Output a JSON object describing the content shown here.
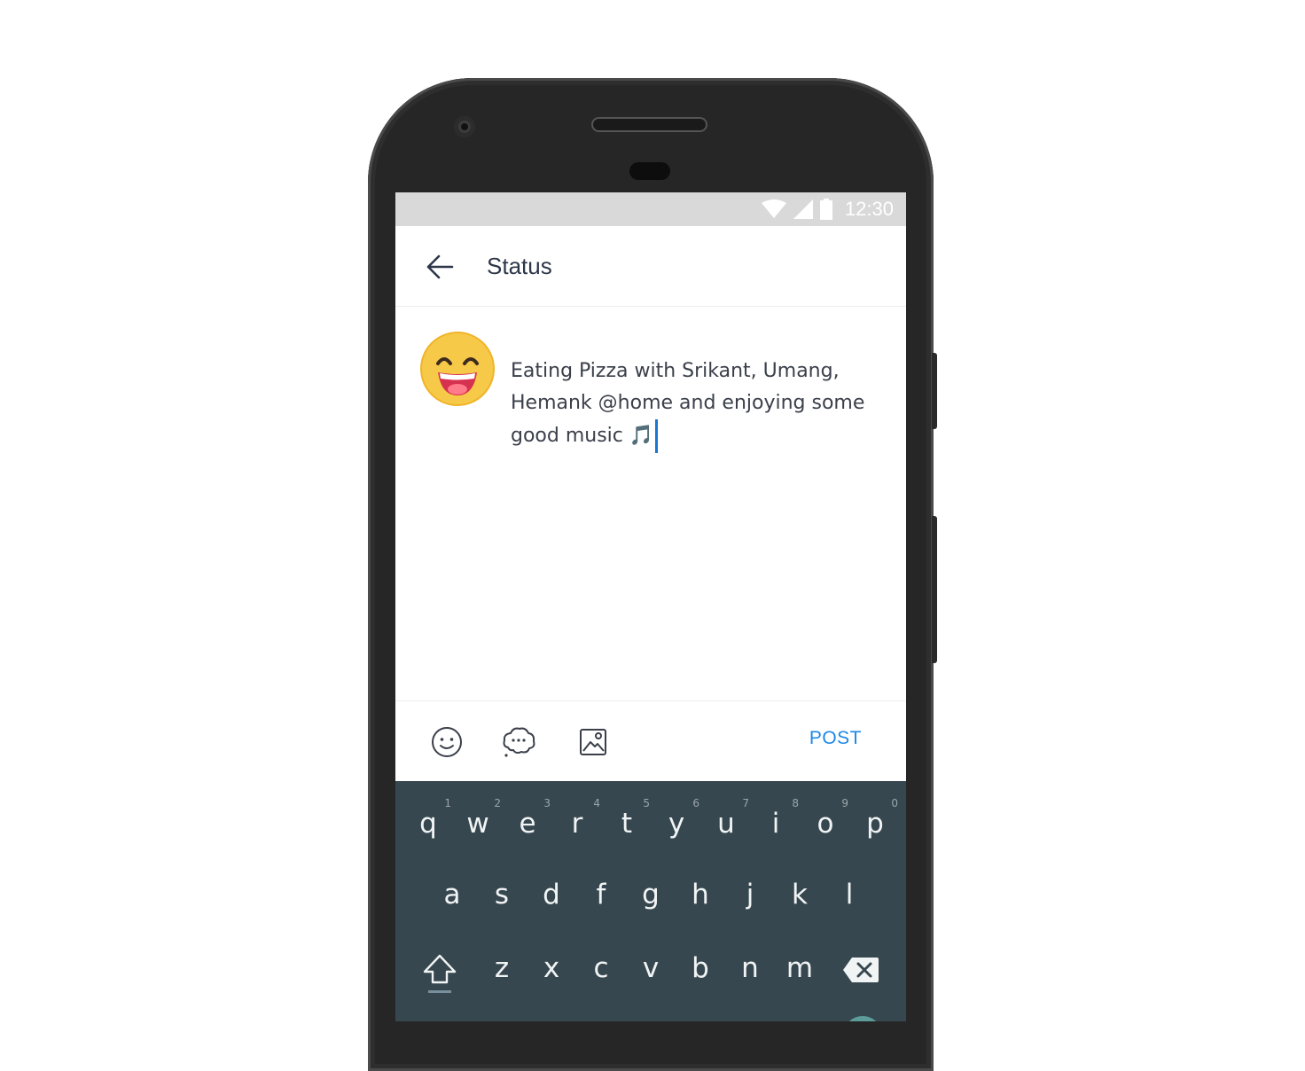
{
  "statusbar": {
    "time": "12:30"
  },
  "appbar": {
    "title": "Status"
  },
  "compose": {
    "text": "Eating Pizza with Srikant, Umang, Hemank @home and enjoying some good music 🎵"
  },
  "toolbar": {
    "post_label": "POST"
  },
  "keyboard": {
    "row1": [
      {
        "label": "q",
        "hint": "1"
      },
      {
        "label": "w",
        "hint": "2"
      },
      {
        "label": "e",
        "hint": "3"
      },
      {
        "label": "r",
        "hint": "4"
      },
      {
        "label": "t",
        "hint": "5"
      },
      {
        "label": "y",
        "hint": "6"
      },
      {
        "label": "u",
        "hint": "7"
      },
      {
        "label": "i",
        "hint": "8"
      },
      {
        "label": "o",
        "hint": "9"
      },
      {
        "label": "p",
        "hint": "0"
      }
    ],
    "row2": [
      "a",
      "s",
      "d",
      "f",
      "g",
      "h",
      "j",
      "k",
      "l"
    ],
    "row3": [
      "z",
      "x",
      "c",
      "v",
      "b",
      "n",
      "m"
    ]
  },
  "colors": {
    "accent": "#1e88e5",
    "keyboard_bg": "#37474f",
    "statusbar_bg": "#d9d9d9"
  },
  "icons": [
    "back-arrow-icon",
    "emoji-icon",
    "sticker-icon",
    "image-icon",
    "shift-icon",
    "backspace-icon"
  ]
}
